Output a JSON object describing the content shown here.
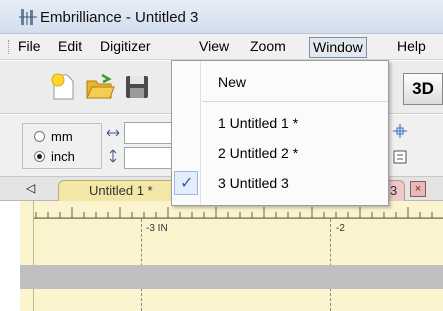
{
  "window": {
    "title": "Embrilliance - Untitled 3"
  },
  "menubar": {
    "items": [
      {
        "label": "File"
      },
      {
        "label": "Edit"
      },
      {
        "label": "Digitizer"
      },
      {
        "label": "View"
      },
      {
        "label": "Zoom"
      },
      {
        "label": "Window",
        "active": true
      },
      {
        "label": "Help"
      }
    ]
  },
  "toolbar": {
    "button_3d": "3D"
  },
  "units": {
    "mm": "mm",
    "inch": "inch",
    "selected": "inch"
  },
  "tabs": {
    "active": "Untitled 1 *",
    "partial_label": "3",
    "close_glyph": "×"
  },
  "ruler": {
    "labels": [
      "-3 IN",
      "-2"
    ]
  },
  "window_menu": {
    "items": [
      {
        "label": "New"
      },
      {
        "label": "1 Untitled 1 *"
      },
      {
        "label": "2 Untitled 2 *"
      },
      {
        "label": "3 Untitled 3",
        "checked": true
      }
    ]
  },
  "colors": {
    "canvas": "#fbf4cf",
    "tab_active": "#f2e7a6",
    "check": "#2a5fa8"
  }
}
